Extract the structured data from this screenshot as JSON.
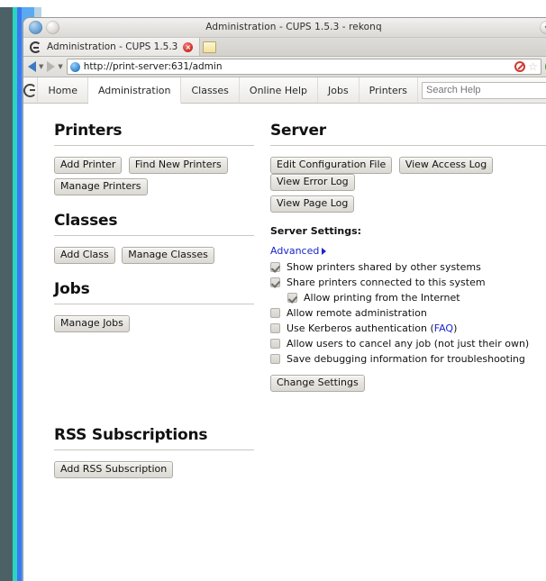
{
  "window": {
    "title": "Administration - CUPS 1.5.3 - rekonq",
    "titlebar_icons": [
      "app-icon",
      "window-orb"
    ],
    "collapse_icon": "chevron-down-icon"
  },
  "browser": {
    "tab": {
      "label": "Administration - CUPS 1.5.3",
      "favicon": "rekonq-icon",
      "close_icon": "close-icon"
    },
    "new_tab_icon": "new-tab-icon",
    "back_icon": "back-arrow-icon",
    "forward_icon": "forward-arrow-icon",
    "url": "http://print-server:631/admin",
    "url_favicon": "globe-icon",
    "noscript_icon": "noscript-icon",
    "bookmark_icon": "star-icon",
    "reload_icon": "reload-icon"
  },
  "cups_nav": {
    "logo": "cups-logo-icon",
    "tabs": [
      {
        "label": "Home",
        "active": false
      },
      {
        "label": "Administration",
        "active": true
      },
      {
        "label": "Classes",
        "active": false
      },
      {
        "label": "Online Help",
        "active": false
      },
      {
        "label": "Jobs",
        "active": false
      },
      {
        "label": "Printers",
        "active": false
      }
    ],
    "search_placeholder": "Search Help",
    "search_value": ""
  },
  "left_column": {
    "printers": {
      "heading": "Printers",
      "buttons": [
        "Add Printer",
        "Find New Printers",
        "Manage Printers"
      ]
    },
    "classes": {
      "heading": "Classes",
      "buttons": [
        "Add Class",
        "Manage Classes"
      ]
    },
    "jobs": {
      "heading": "Jobs",
      "buttons": [
        "Manage Jobs"
      ]
    },
    "rss": {
      "heading": "RSS Subscriptions",
      "buttons": [
        "Add RSS Subscription"
      ]
    }
  },
  "right_column": {
    "server": {
      "heading": "Server",
      "buttons": [
        "Edit Configuration File",
        "View Access Log",
        "View Error Log",
        "View Page Log"
      ],
      "settings_label": "Server Settings:",
      "advanced_link": "Advanced",
      "options": [
        {
          "label": "Show printers shared by other systems",
          "checked": true,
          "indent": false
        },
        {
          "label": "Share printers connected to this system",
          "checked": true,
          "indent": false
        },
        {
          "label": "Allow printing from the Internet",
          "checked": true,
          "indent": true
        },
        {
          "label": "Allow remote administration",
          "checked": false,
          "indent": false
        },
        {
          "label": "Use Kerberos authentication (",
          "checked": false,
          "indent": false,
          "link": "FAQ",
          "suffix": ")"
        },
        {
          "label": "Allow users to cancel any job (not just their own)",
          "checked": false,
          "indent": false
        },
        {
          "label": "Save debugging information for troubleshooting",
          "checked": false,
          "indent": false
        }
      ],
      "change_button": "Change Settings"
    }
  },
  "colors": {
    "link": "#1b25c8",
    "glow_outer": "#4c6166",
    "glow_cyan": "#2ad4c2",
    "glow_blue": "#3b78f0",
    "glow_light": "#5aa9f2"
  }
}
